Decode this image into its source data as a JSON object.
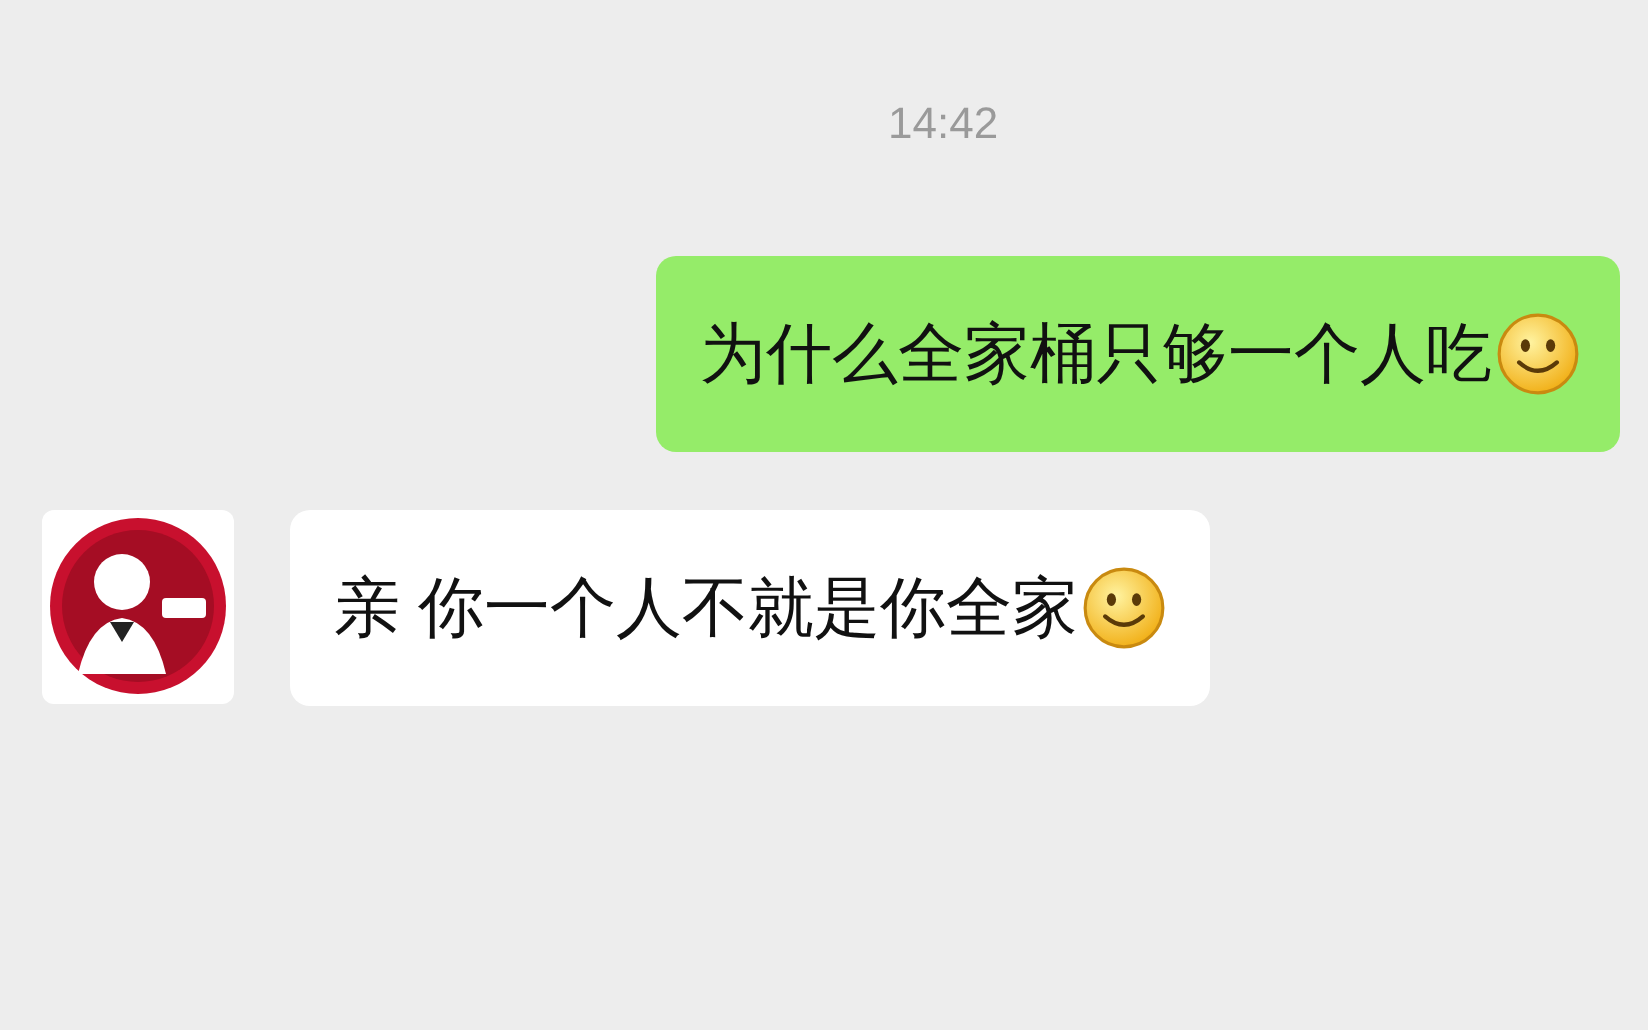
{
  "timestamp": "14:42",
  "messages": [
    {
      "kind": "sent",
      "text": "为什么全家桶只够一个人吃",
      "trailing_emoji": true
    },
    {
      "kind": "received",
      "text": "亲 你一个人不就是你全家",
      "trailing_emoji": true
    }
  ]
}
